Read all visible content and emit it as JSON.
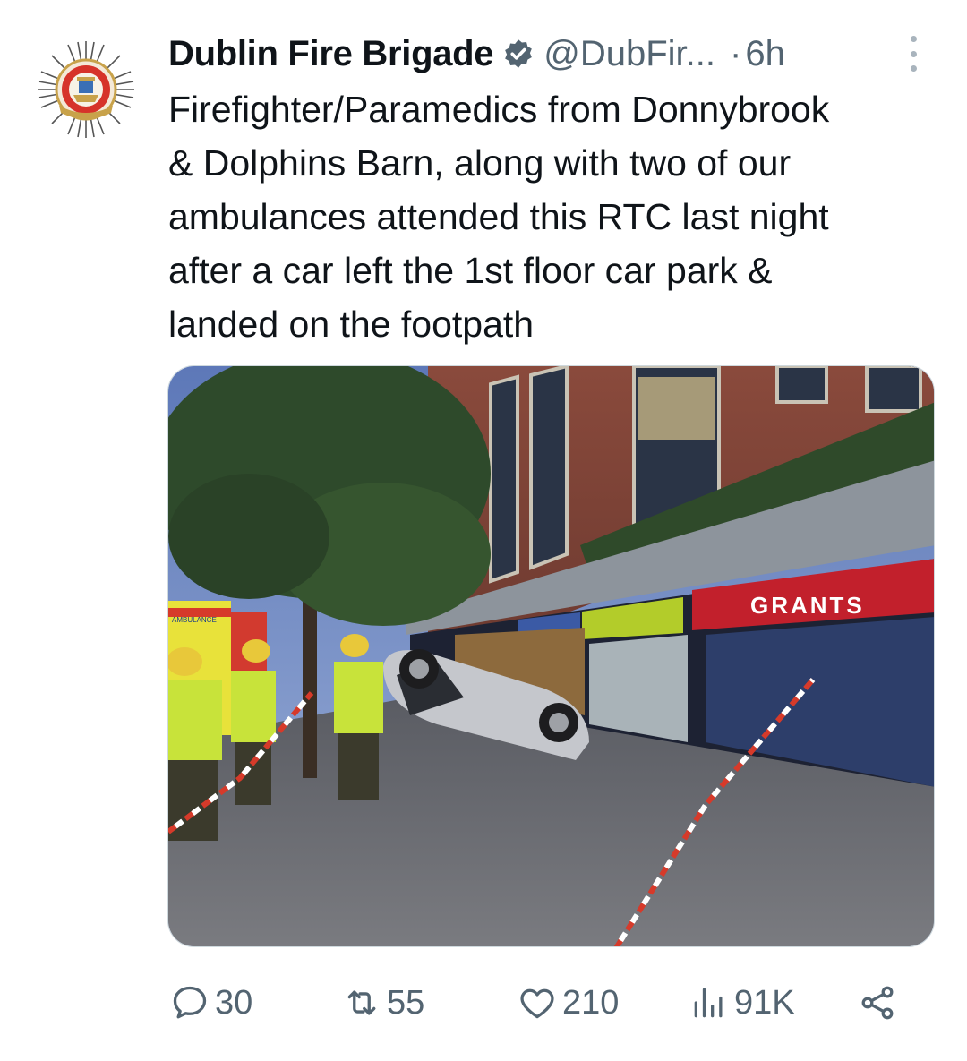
{
  "tweet": {
    "author": {
      "display_name": "Dublin Fire Brigade",
      "handle": "@DubFir...",
      "verified": true,
      "avatar_icon": "dublin-fire-brigade-crest"
    },
    "separator": "·",
    "timestamp": "6h",
    "text_lines": [
      "Firefighter/Paramedics from Donnybrook",
      "& Dolphins Barn, along with two of our",
      "ambulances attended this RTC last night",
      "after a car left the 1st floor car park &",
      "landed on the footpath"
    ],
    "media": {
      "type": "photo",
      "shop_sign": "GRANTS",
      "ambulance_label": "AMBULANCE"
    },
    "actions": {
      "replies": "30",
      "retweets": "55",
      "likes": "210",
      "views": "91K"
    }
  },
  "colors": {
    "text_primary": "#0f1419",
    "text_secondary": "#536471",
    "verified_blue": "#536471",
    "divider": "#e6e9ec"
  }
}
